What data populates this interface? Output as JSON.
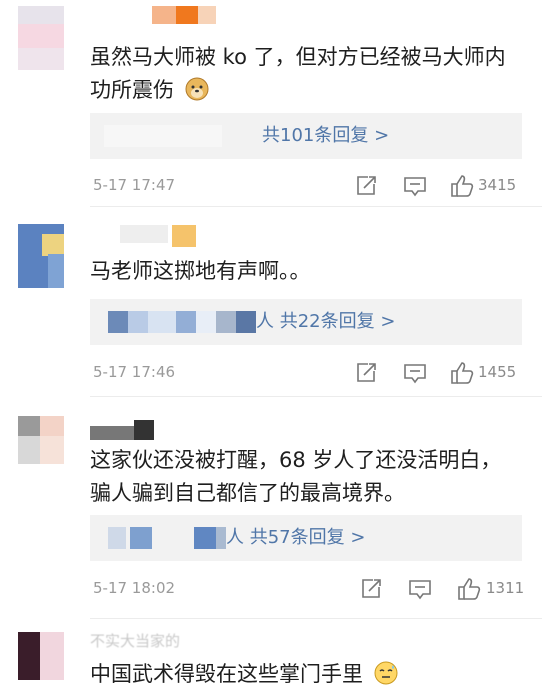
{
  "comments": [
    {
      "text_lines": [
        "虽然马大师被 ko 了，但对方已经被马大师内",
        "功所震伤"
      ],
      "emoji": "doge-emoji",
      "replies_label": "共101条回复 >",
      "time": "5-17 17:47",
      "likes": "3415"
    },
    {
      "text_lines": [
        "马老师这掷地有声啊。。"
      ],
      "replies_label": "人 共22条回复 >",
      "time": "5-17 17:46",
      "likes": "1455"
    },
    {
      "text_lines": [
        "这家伙还没被打醒，68 岁人了还没活明白，",
        "骗人骗到自己都信了的最高境界。"
      ],
      "replies_label": "人 共57条回复 >",
      "time": "5-17 18:02",
      "likes": "1311"
    },
    {
      "name_partial": "不实大当家的",
      "text_lines": [
        "中国武术得毁在这些掌门手里"
      ],
      "emoji": "sweat-emoji"
    }
  ],
  "colors": {
    "link": "#5076a8",
    "muted": "#9a9a9a",
    "reply_bg": "#f2f2f2"
  }
}
